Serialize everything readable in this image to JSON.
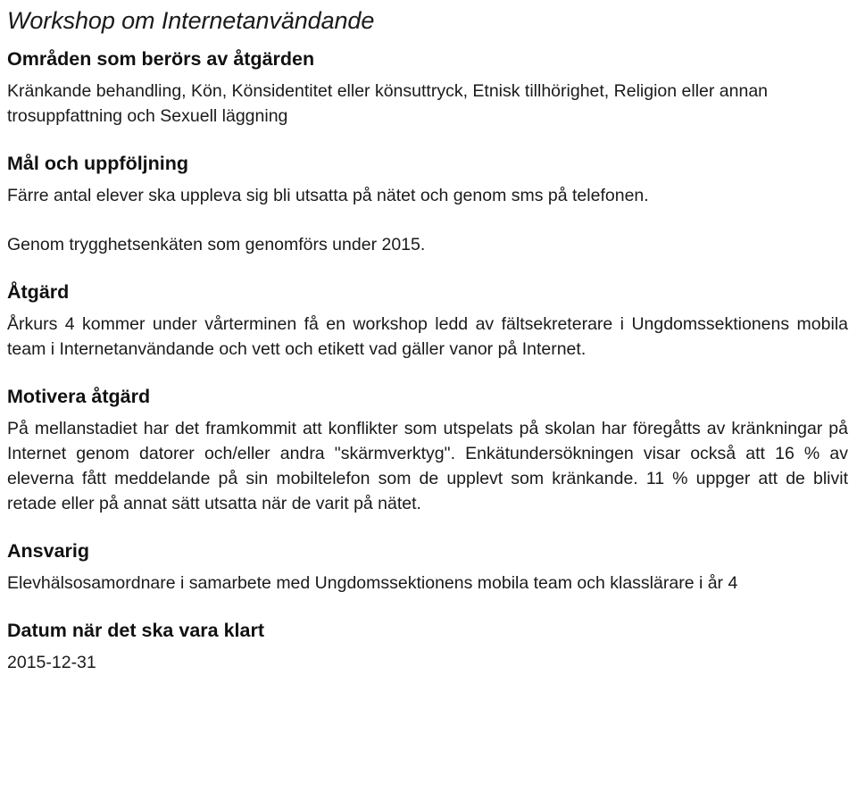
{
  "document": {
    "title": "Workshop om Internetanvändande",
    "sections": [
      {
        "heading": "Områden som berörs av åtgärden",
        "paragraphs": [
          "Kränkande behandling, Kön, Könsidentitet eller könsuttryck, Etnisk tillhörighet, Religion eller annan trosuppfattning och Sexuell läggning"
        ]
      },
      {
        "heading": "Mål och uppföljning",
        "paragraphs": [
          "Färre antal elever ska uppleva sig bli utsatta på nätet och genom sms på telefonen.",
          "Genom trygghetsenkäten som genomförs under 2015."
        ]
      },
      {
        "heading": "Åtgärd",
        "paragraphs": [
          "Årkurs 4 kommer under vårterminen få en workshop ledd av fältsekreterare i Ungdomssektionens mobila team i Internetanvändande och vett och etikett vad gäller vanor på Internet."
        ]
      },
      {
        "heading": "Motivera åtgärd",
        "paragraphs": [
          "På mellanstadiet har det framkommit att konflikter som utspelats på skolan har föregåtts av kränkningar på Internet genom datorer och/eller andra \"skärmverktyg\". Enkätundersökningen visar också att 16 % av eleverna fått meddelande på sin mobiltelefon som de upplevt som kränkande. 11 % uppger att de blivit retade eller på annat sätt utsatta när de varit på nätet."
        ]
      },
      {
        "heading": "Ansvarig",
        "paragraphs": [
          "Elevhälsosamordnare i samarbete med Ungdomssektionens mobila team och klasslärare i år 4"
        ]
      },
      {
        "heading": "Datum när det ska vara klart",
        "paragraphs": [
          "2015-12-31"
        ]
      }
    ]
  },
  "colors": {
    "text": "#1a1a1a",
    "heading": "#111111",
    "background": "#ffffff"
  }
}
